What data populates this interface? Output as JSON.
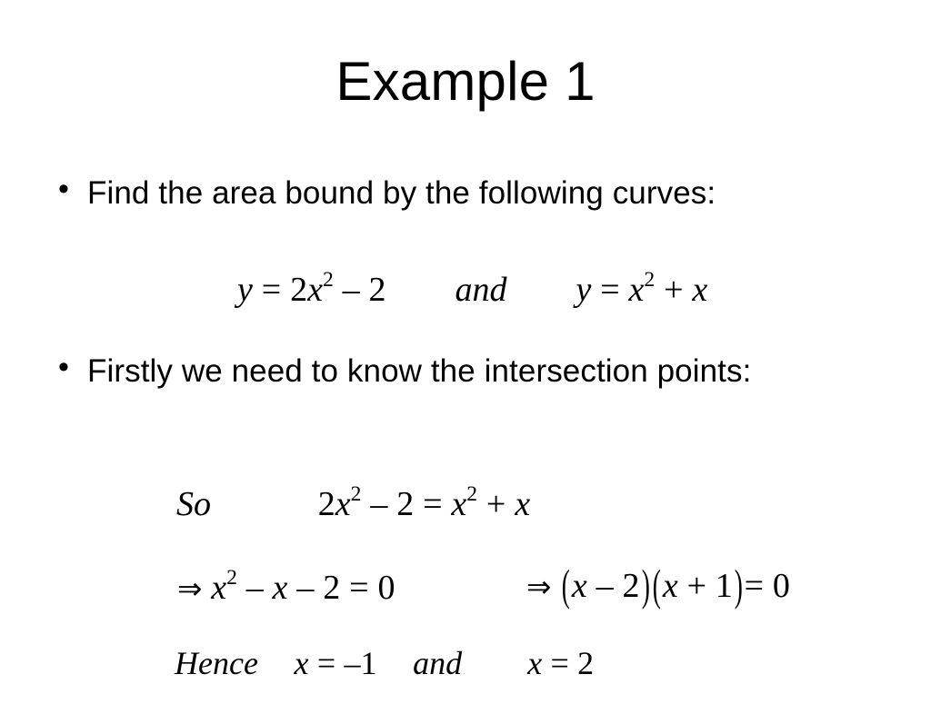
{
  "slide": {
    "title": "Example 1",
    "background_color": "#ffffff",
    "text_color": "#000000"
  },
  "bullets": [
    {
      "marker": "•",
      "text": "Find the area bound by the following curves:"
    },
    {
      "marker": "•",
      "text": "Firstly we need to know the intersection points:"
    }
  ],
  "equations": {
    "curves": {
      "plain": "y = 2x² – 2      and      y = x² + x",
      "lhs_y": "y",
      "eq_sign": "=",
      "lhs_coeff": "2",
      "lhs_var": "x",
      "lhs_exp": "2",
      "lhs_minus": "–",
      "lhs_const": "2",
      "conjunction": "and",
      "rhs_y": "y",
      "rhs_var": "x",
      "rhs_exp": "2",
      "rhs_plus": "+",
      "rhs_term": "x"
    },
    "so": {
      "plain": "So        2x² – 2 = x² + x",
      "label": "So",
      "left_coeff": "2",
      "left_var": "x",
      "left_exp": "2",
      "left_minus": "–",
      "left_const": "2",
      "eq_sign": "=",
      "right_var": "x",
      "right_exp": "2",
      "right_plus": "+",
      "right_term": "x"
    },
    "expand": {
      "plain": "⇒ x² – x – 2 = 0",
      "arrow": "⇒",
      "var": "x",
      "exp": "2",
      "minus_1": "–",
      "term": "x",
      "minus_2": "–",
      "const": "2",
      "eq_sign": "=",
      "result": "0"
    },
    "factor": {
      "plain": "⇒ (x – 2)(x + 1) = 0",
      "arrow": "⇒",
      "open_1": "(",
      "var_1": "x",
      "minus": "–",
      "const_1": "2",
      "close_1": ")",
      "open_2": "(",
      "var_2": "x",
      "plus": "+",
      "const_2": "1",
      "close_2": ")",
      "eq_sign": "=",
      "result": "0"
    },
    "hence": {
      "plain": "Hence  x = –1  and      x = 2",
      "label": "Hence",
      "var_1": "x",
      "eq_1": "=",
      "value_1": "–1",
      "conjunction": "and",
      "var_2": "x",
      "eq_2": "=",
      "value_2": "2"
    }
  }
}
